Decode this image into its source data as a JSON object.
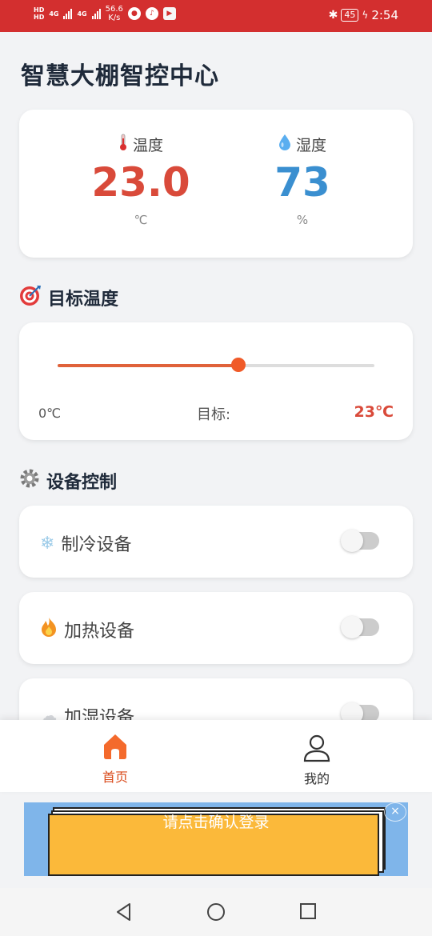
{
  "status_bar": {
    "hd1": "HD",
    "hd2": "HD",
    "sig1": "4G",
    "sig2": "4G",
    "net_speed": "56.6",
    "net_unit": "K/s",
    "battery": "45",
    "time": "2:54"
  },
  "page_title": "智慧大棚智控中心",
  "sensors": {
    "temperature": {
      "label": "温度",
      "value": "23.0",
      "unit": "℃"
    },
    "humidity": {
      "label": "湿度",
      "value": "73",
      "unit": "%"
    }
  },
  "target": {
    "title": "目标温度",
    "min_label": "0℃",
    "label": "目标:",
    "value_label": "23℃",
    "slider_fraction": 0.57
  },
  "devices": {
    "title": "设备控制",
    "items": [
      {
        "name": "制冷设备",
        "on": false
      },
      {
        "name": "加热设备",
        "on": false
      },
      {
        "name": "加湿设备",
        "on": false
      }
    ]
  },
  "tabs": [
    {
      "label": "首页",
      "active": true
    },
    {
      "label": "我的",
      "active": false
    }
  ],
  "banner": {
    "text": "请点击确认登录",
    "close": "×"
  },
  "colors": {
    "accent": "#d94a1a",
    "temp": "#d94a3a",
    "humidity": "#3a8fd0",
    "status_bar": "#d32f2f"
  }
}
